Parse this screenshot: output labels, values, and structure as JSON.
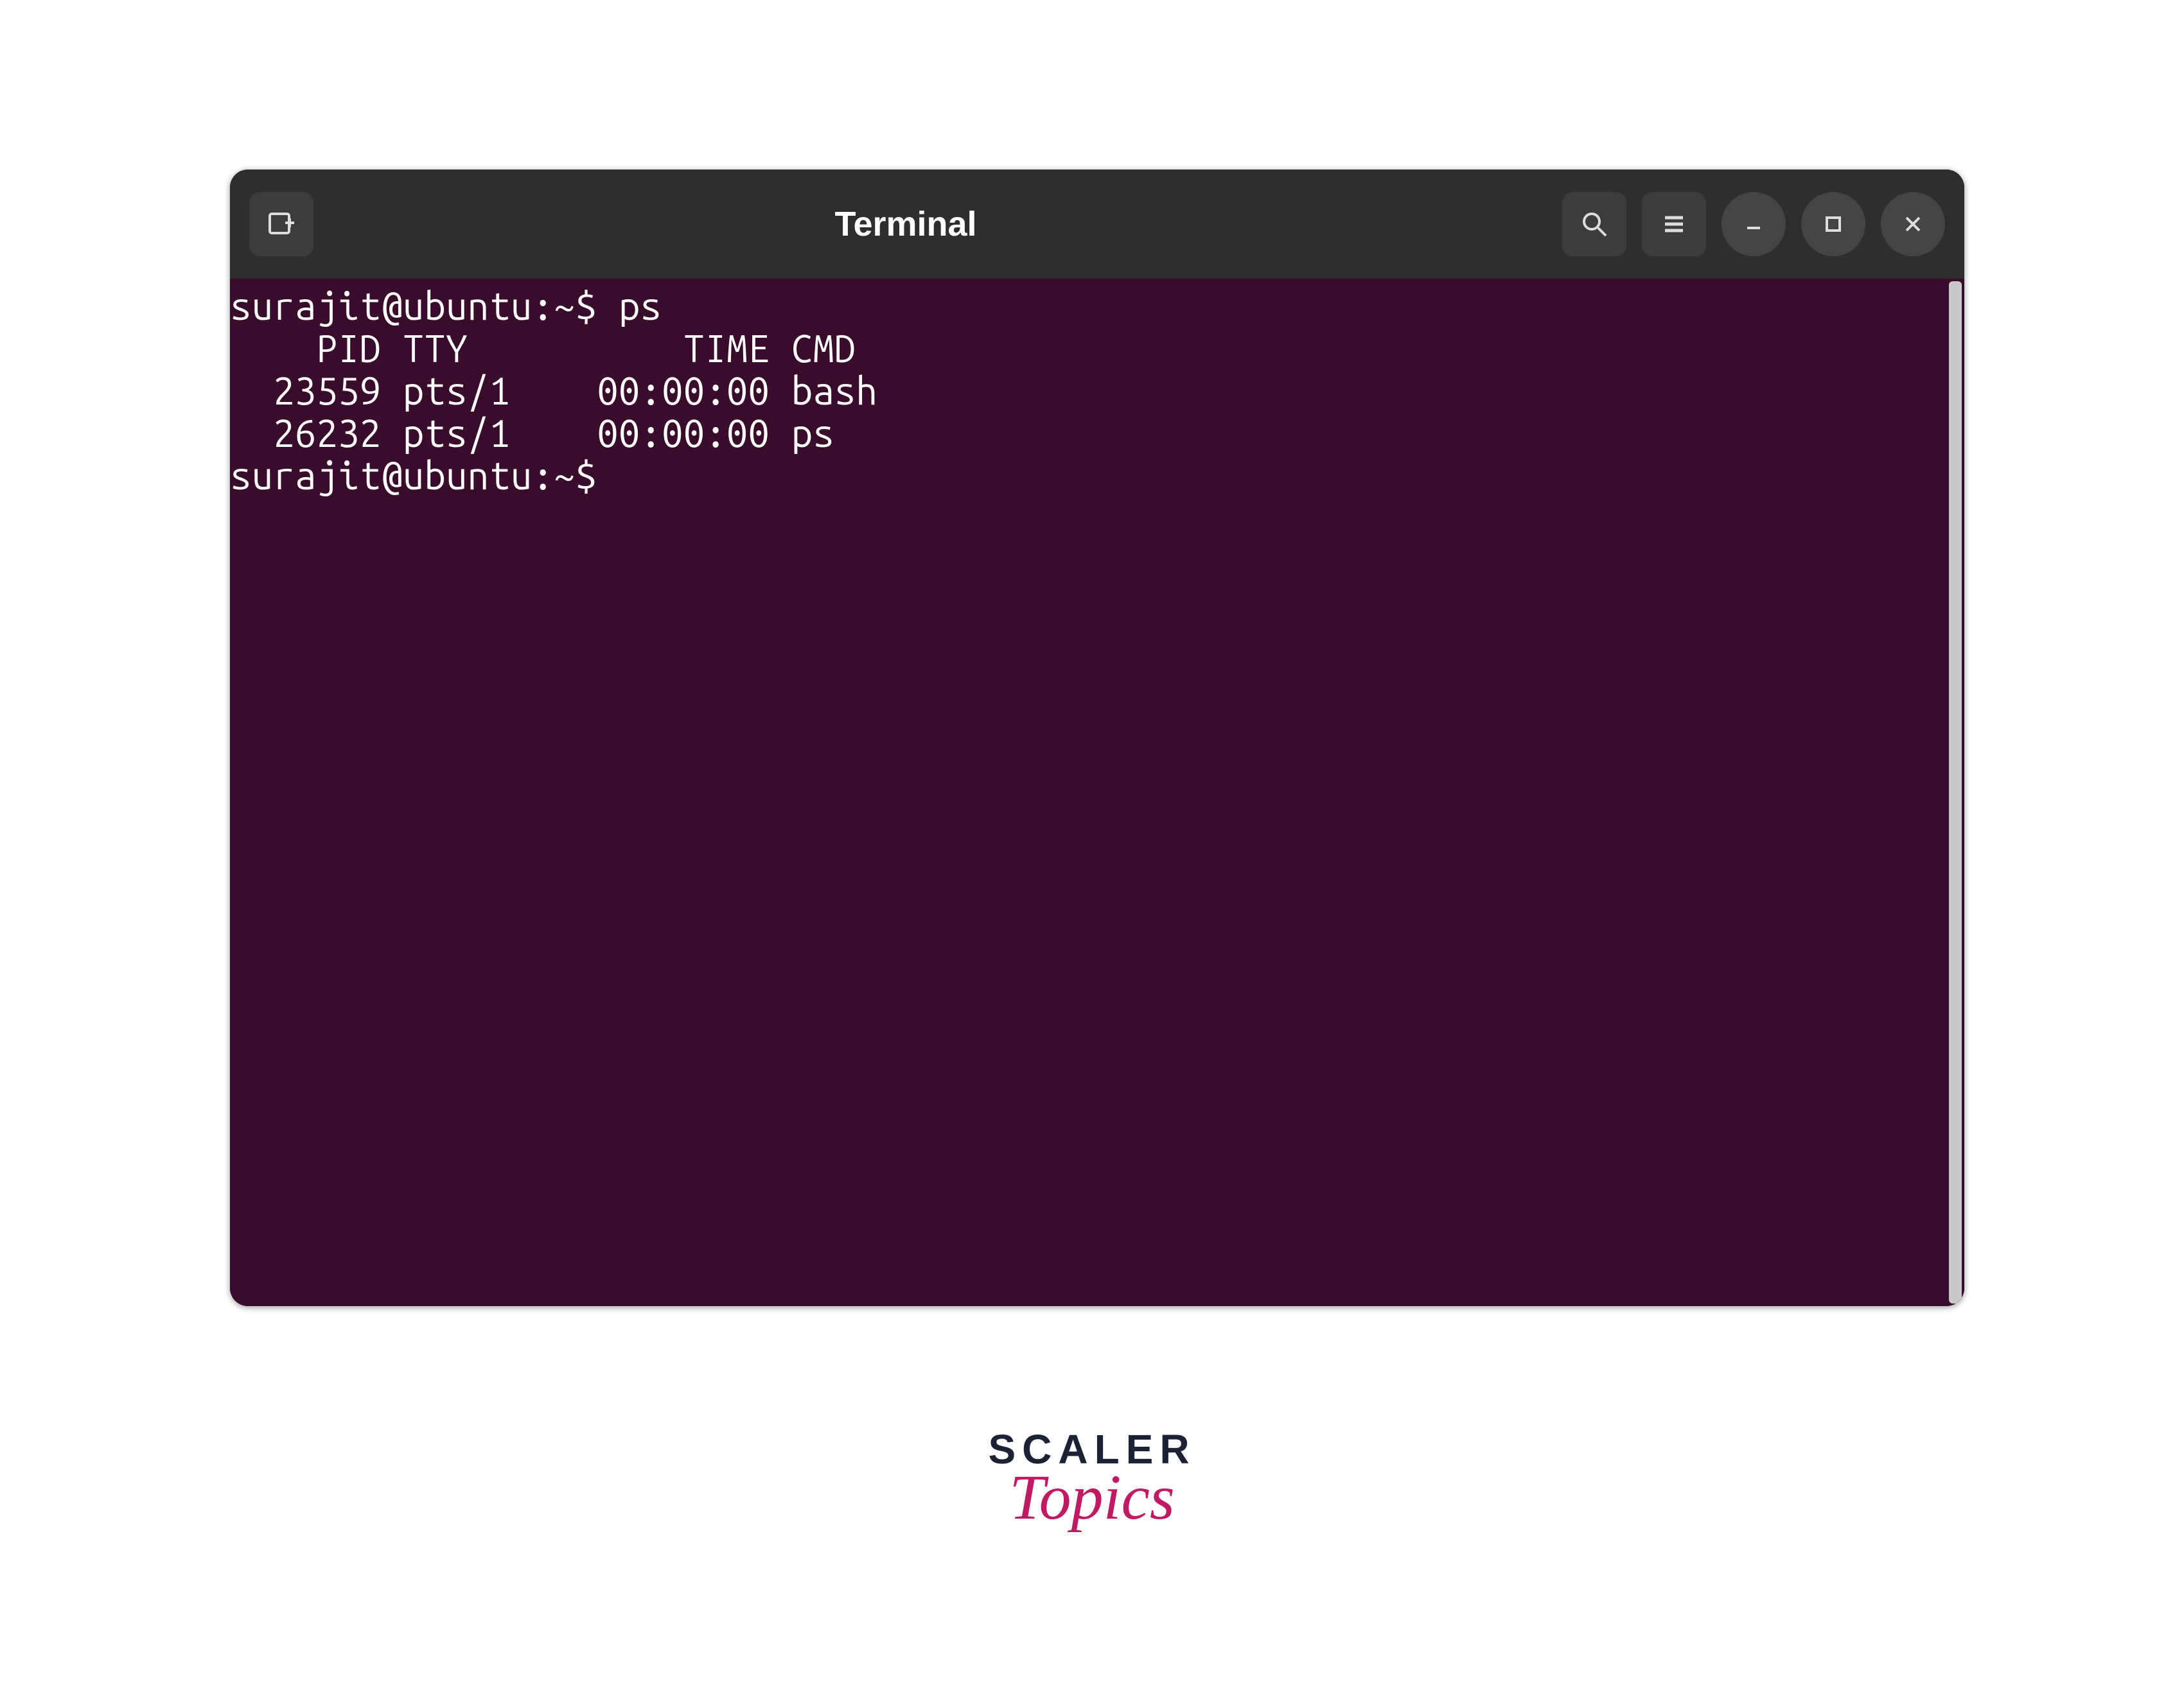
{
  "window": {
    "title": "Terminal"
  },
  "terminal": {
    "prompt1": "surajit@ubuntu:~$ ",
    "command1": "ps",
    "header": "    PID TTY          TIME CMD",
    "row1": "  23559 pts/1    00:00:00 bash",
    "row2": "  26232 pts/1    00:00:00 ps",
    "prompt2": "surajit@ubuntu:~$ "
  },
  "branding": {
    "main": "SCALER",
    "sub": "Topics"
  }
}
